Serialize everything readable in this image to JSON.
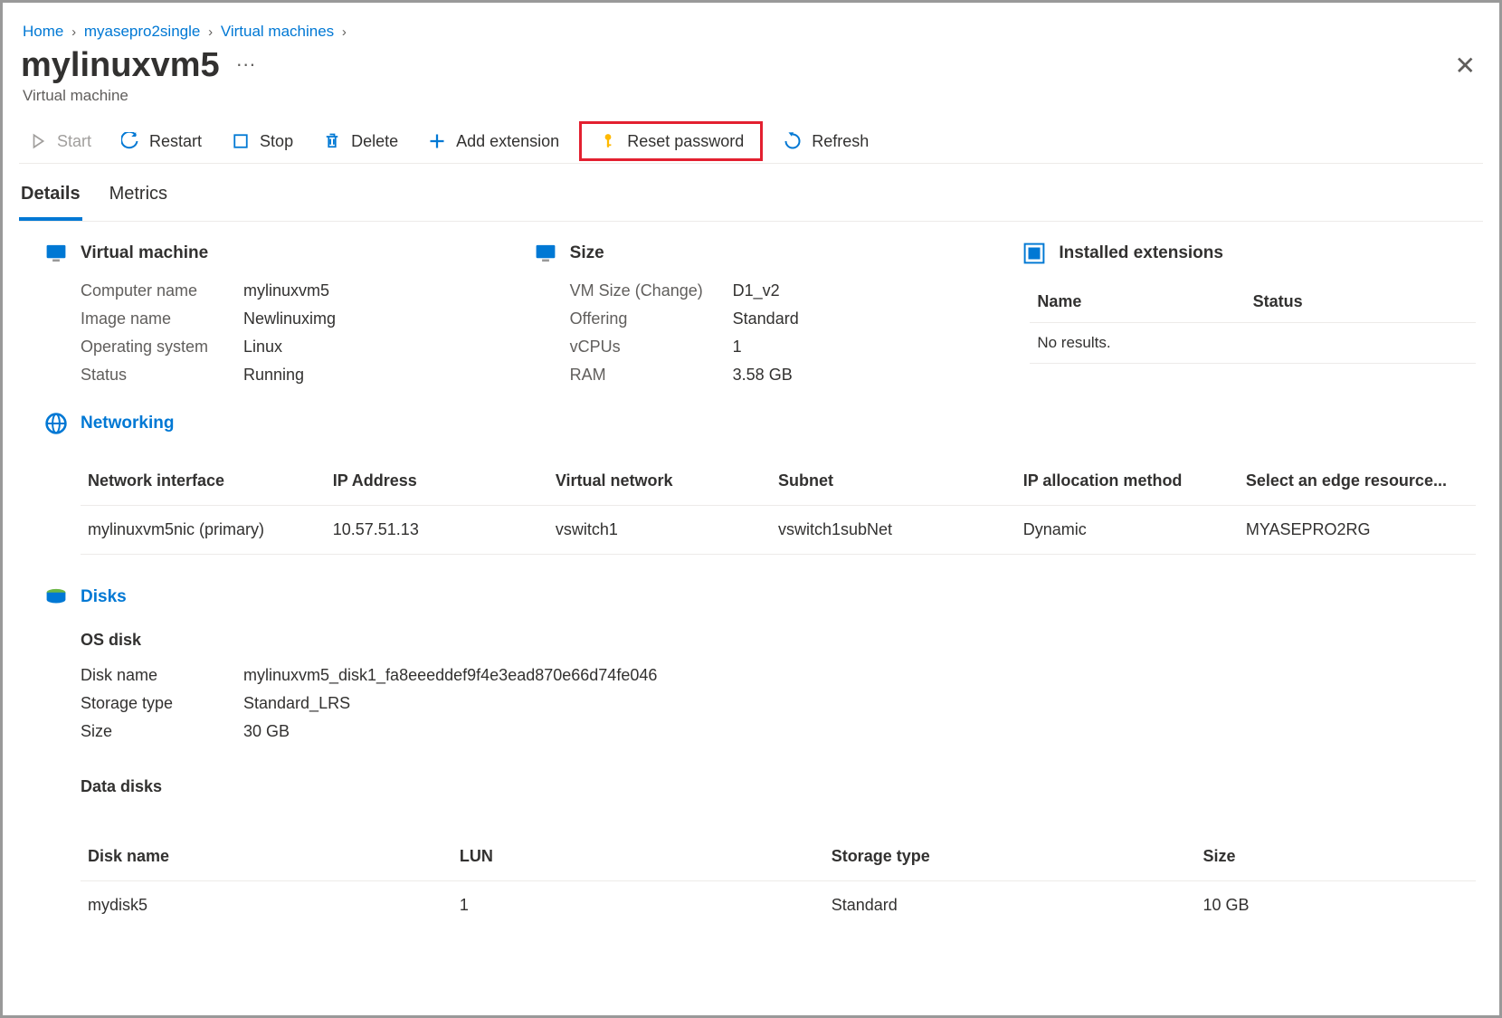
{
  "breadcrumb": {
    "home": "Home",
    "item1": "myasepro2single",
    "item2": "Virtual machines"
  },
  "header": {
    "title": "mylinuxvm5",
    "subtitle": "Virtual machine"
  },
  "toolbar": {
    "start": "Start",
    "restart": "Restart",
    "stop": "Stop",
    "delete": "Delete",
    "add_extension": "Add extension",
    "reset_password": "Reset password",
    "refresh": "Refresh"
  },
  "tabs": {
    "details": "Details",
    "metrics": "Metrics"
  },
  "vm": {
    "section": "Virtual machine",
    "labels": {
      "computer_name": "Computer name",
      "image_name": "Image name",
      "os": "Operating system",
      "status": "Status"
    },
    "values": {
      "computer_name": "mylinuxvm5",
      "image_name": "Newlinuximg",
      "os": "Linux",
      "status": "Running"
    }
  },
  "size": {
    "section": "Size",
    "labels": {
      "vm_size": "VM Size",
      "change": "Change",
      "offering": "Offering",
      "vcpus": "vCPUs",
      "ram": "RAM"
    },
    "values": {
      "vm_size": "D1_v2",
      "offering": "Standard",
      "vcpus": "1",
      "ram": "3.58 GB"
    }
  },
  "extensions": {
    "section": "Installed extensions",
    "cols": {
      "name": "Name",
      "status": "Status"
    },
    "no_results": "No results."
  },
  "networking": {
    "section": "Networking",
    "cols": {
      "nic": "Network interface",
      "ip": "IP Address",
      "vnet": "Virtual network",
      "subnet": "Subnet",
      "alloc": "IP allocation method",
      "edge": "Select an edge resource..."
    },
    "row": {
      "nic": "mylinuxvm5nic (primary)",
      "ip": "10.57.51.13",
      "vnet": "vswitch1",
      "subnet": "vswitch1subNet",
      "alloc": "Dynamic",
      "edge": "MYASEPRO2RG"
    }
  },
  "disks": {
    "section": "Disks",
    "os_disk_head": "OS disk",
    "labels": {
      "disk_name": "Disk name",
      "storage_type": "Storage type",
      "size": "Size"
    },
    "values": {
      "disk_name": "mylinuxvm5_disk1_fa8eeeddef9f4e3ead870e66d74fe046",
      "storage_type": "Standard_LRS",
      "size": "30 GB"
    },
    "data_disks_head": "Data disks",
    "cols": {
      "disk_name": "Disk name",
      "lun": "LUN",
      "storage_type": "Storage type",
      "size": "Size"
    },
    "row": {
      "disk_name": "mydisk5",
      "lun": "1",
      "storage_type": "Standard",
      "size": "10 GB"
    }
  }
}
